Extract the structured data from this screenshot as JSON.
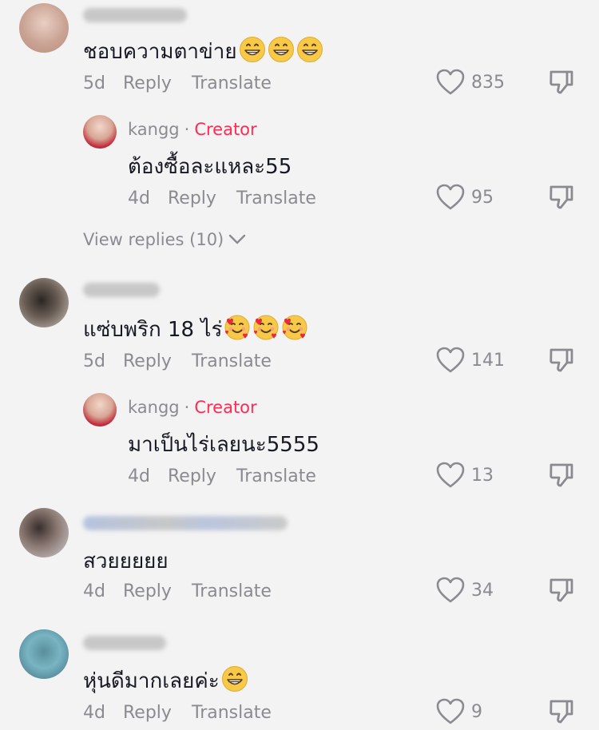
{
  "comments": [
    {
      "text": "ชอบความตาข่าย",
      "emoji_count": 3,
      "emoji": "grin",
      "date": "5d",
      "reply": "Reply",
      "translate": "Translate",
      "likes": "835",
      "avatar_colors": [
        "#c9a89b",
        "#e9d2c6"
      ]
    },
    {
      "username": "kangg",
      "creator_label": "Creator",
      "text": "ต้องซื้อละแหละ55",
      "date": "4d",
      "reply": "Reply",
      "translate": "Translate",
      "likes": "95"
    },
    {
      "text": "แซ่บพริก 18 ไร่",
      "emoji_count": 3,
      "emoji": "hearts",
      "date": "5d",
      "reply": "Reply",
      "translate": "Translate",
      "likes": "141"
    },
    {
      "username": "kangg",
      "creator_label": "Creator",
      "text": "มาเป็นไร่เลยนะ5555",
      "date": "4d",
      "reply": "Reply",
      "translate": "Translate",
      "likes": "13"
    },
    {
      "text": "สวยยยยย",
      "date": "4d",
      "reply": "Reply",
      "translate": "Translate",
      "likes": "34"
    },
    {
      "text": "หุ่นดีมากเลยค่ะ",
      "emoji_count": 1,
      "emoji": "grin",
      "date": "4d",
      "reply": "Reply",
      "translate": "Translate",
      "likes": "9"
    }
  ],
  "view_replies": "View replies (10)",
  "colors": {
    "creator": "#fe2c55",
    "muted": "#8a8b91",
    "text": "#161823",
    "background": "#f3f3f3"
  }
}
